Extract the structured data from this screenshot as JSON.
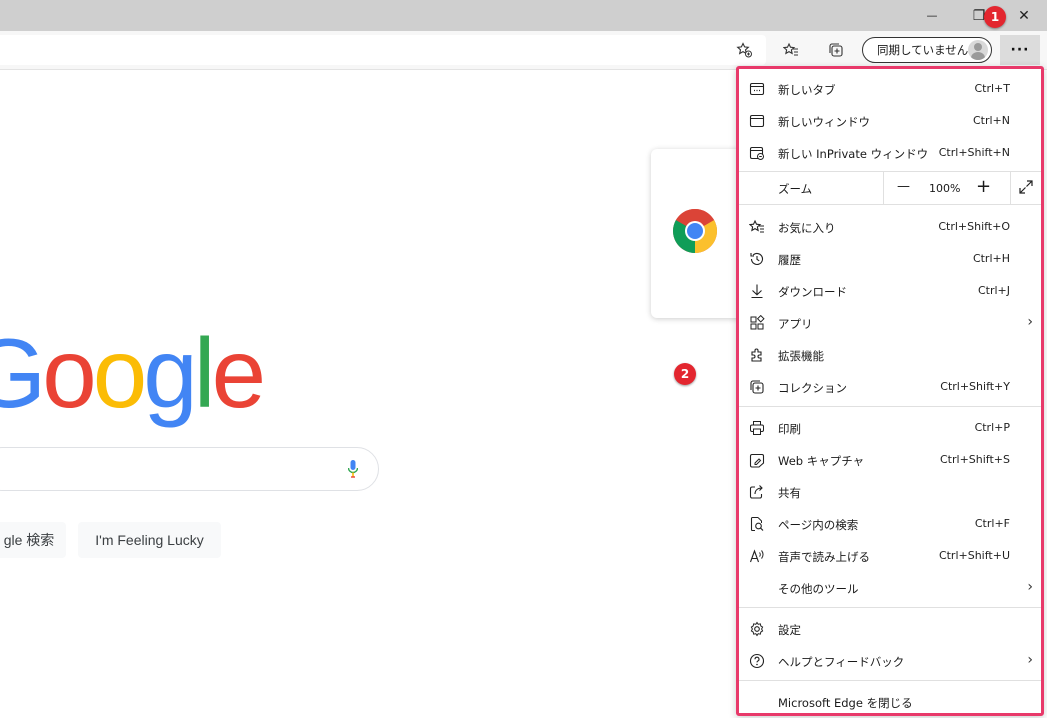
{
  "window": {
    "minimize_glyph": "—",
    "restore_glyph": "❐",
    "close_glyph": "✕"
  },
  "toolbar": {
    "sync_label": "同期していません",
    "more_glyph": "···",
    "icons": [
      "add-favorite-icon",
      "favorites-icon",
      "collections-icon"
    ]
  },
  "badges": {
    "one": "1",
    "two": "2"
  },
  "google": {
    "search_button": "gle 検索",
    "lucky_button": "I'm Feeling Lucky"
  },
  "menu": {
    "items": [
      {
        "label": "新しいタブ",
        "shortcut": "Ctrl+T",
        "icon": "new-tab-icon"
      },
      {
        "label": "新しいウィンドウ",
        "shortcut": "Ctrl+N",
        "icon": "new-window-icon"
      },
      {
        "label": "新しい InPrivate ウィンドウ",
        "shortcut": "Ctrl+Shift+N",
        "icon": "inprivate-icon"
      },
      {
        "label": "お気に入り",
        "shortcut": "Ctrl+Shift+O",
        "icon": "favorites-icon"
      },
      {
        "label": "履歴",
        "shortcut": "Ctrl+H",
        "icon": "history-icon"
      },
      {
        "label": "ダウンロード",
        "shortcut": "Ctrl+J",
        "icon": "download-icon"
      },
      {
        "label": "アプリ",
        "shortcut": "",
        "icon": "apps-icon"
      },
      {
        "label": "拡張機能",
        "shortcut": "",
        "icon": "extensions-icon"
      },
      {
        "label": "コレクション",
        "shortcut": "Ctrl+Shift+Y",
        "icon": "collections-icon"
      },
      {
        "label": "印刷",
        "shortcut": "Ctrl+P",
        "icon": "print-icon"
      },
      {
        "label": "Web キャプチャ",
        "shortcut": "Ctrl+Shift+S",
        "icon": "web-capture-icon"
      },
      {
        "label": "共有",
        "shortcut": "",
        "icon": "share-icon"
      },
      {
        "label": "ページ内の検索",
        "shortcut": "Ctrl+F",
        "icon": "find-on-page-icon"
      },
      {
        "label": "音声で読み上げる",
        "shortcut": "Ctrl+Shift+U",
        "icon": "read-aloud-icon"
      },
      {
        "label": "その他のツール",
        "shortcut": "",
        "icon": ""
      },
      {
        "label": "設定",
        "shortcut": "",
        "icon": "settings-icon"
      },
      {
        "label": "ヘルプとフィードバック",
        "shortcut": "",
        "icon": "help-icon"
      },
      {
        "label": "Microsoft Edge を閉じる",
        "shortcut": "",
        "icon": ""
      }
    ],
    "zoom": {
      "label": "ズーム",
      "value": "100%",
      "minus": "—",
      "plus": "+"
    },
    "arrow_glyph": "›"
  }
}
